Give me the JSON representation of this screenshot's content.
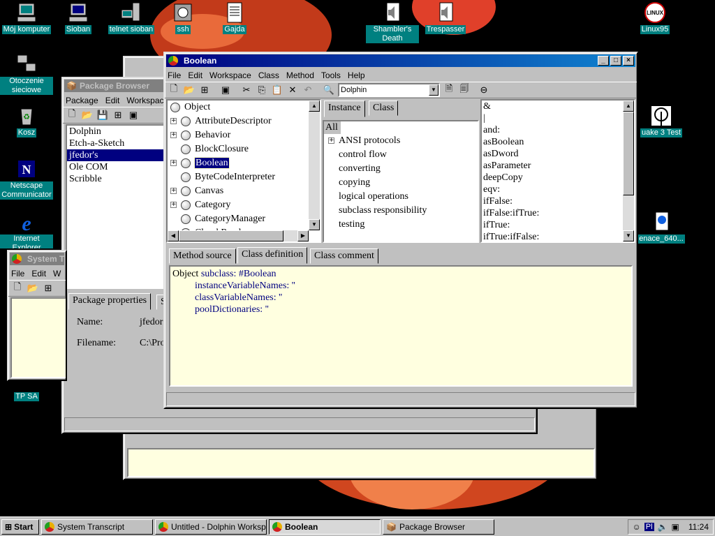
{
  "desktop_icons": [
    {
      "name": "my-computer",
      "label": "Mój komputer",
      "icon": "computer-icon"
    },
    {
      "name": "sioban",
      "label": "Sioban",
      "icon": "computer-icon"
    },
    {
      "name": "telnet-sioban",
      "label": "telnet sioban",
      "icon": "network-icon"
    },
    {
      "name": "ssh",
      "label": "ssh",
      "icon": "safe-icon"
    },
    {
      "name": "gajda",
      "label": "Gajda",
      "icon": "document-icon"
    },
    {
      "name": "shamblers-death",
      "label": "Shambler's Death",
      "icon": "sound-icon"
    },
    {
      "name": "trespasser",
      "label": "Trespasser",
      "icon": "sound-icon"
    },
    {
      "name": "linux95",
      "label": "Linux95",
      "icon": "linux-icon"
    },
    {
      "name": "network-neighborhood",
      "label": "Otoczenie sieciowe",
      "icon": "network-icon"
    },
    {
      "name": "recycle-bin",
      "label": "Kosz",
      "icon": "recycle-icon"
    },
    {
      "name": "netscape",
      "label": "Netscape Communicator",
      "icon": "netscape-icon"
    },
    {
      "name": "internet-explorer",
      "label": "Internet Explorer",
      "icon": "ie-icon"
    },
    {
      "name": "tp-sa",
      "label": "TP SA",
      "icon": "phone-icon"
    },
    {
      "name": "quake3",
      "label": "uake 3 Test",
      "icon": "quake-icon"
    },
    {
      "name": "menace",
      "label": "enace_640...",
      "icon": "movie-icon"
    }
  ],
  "workspace_window": {
    "title": "Untitled - Dolphin Workspace"
  },
  "system_transcript": {
    "title": "System T",
    "menu": [
      "File",
      "Edit",
      "W"
    ]
  },
  "package_browser": {
    "title": "Package Browser",
    "menu": [
      "Package",
      "Edit",
      "Workspac"
    ],
    "packages": [
      "Dolphin",
      "Etch-a-Sketch",
      "jfedor's",
      "Ole COM",
      "Scribble"
    ],
    "selected_package": "jfedor's",
    "tabs": [
      "Package properties",
      "S"
    ],
    "props": [
      {
        "label": "Name:",
        "value": "jfedor"
      },
      {
        "label": "Filename:",
        "value": "C:\\Pro"
      }
    ]
  },
  "boolean_window": {
    "title": "Boolean",
    "menu": [
      "File",
      "Edit",
      "Workspace",
      "Class",
      "Method",
      "Tools",
      "Help"
    ],
    "namespace_combo": "Dolphin",
    "class_tree": [
      {
        "label": "Object",
        "expander": "",
        "level": 0
      },
      {
        "label": "AttributeDescriptor",
        "expander": "+",
        "level": 1
      },
      {
        "label": "Behavior",
        "expander": "+",
        "level": 1
      },
      {
        "label": "BlockClosure",
        "expander": "",
        "level": 1
      },
      {
        "label": "Boolean",
        "expander": "+",
        "level": 1,
        "selected": true
      },
      {
        "label": "ByteCodeInterpreter",
        "expander": "",
        "level": 1
      },
      {
        "label": "Canvas",
        "expander": "+",
        "level": 1
      },
      {
        "label": "Category",
        "expander": "+",
        "level": 1
      },
      {
        "label": "CategoryManager",
        "expander": "",
        "level": 1
      },
      {
        "label": "ChunkReader",
        "expander": "",
        "level": 1
      }
    ],
    "side_tabs": [
      "Instance",
      "Class"
    ],
    "categories_all": "All",
    "categories": [
      {
        "label": "ANSI protocols",
        "expander": "+"
      },
      {
        "label": "control flow",
        "expander": ""
      },
      {
        "label": "converting",
        "expander": ""
      },
      {
        "label": "copying",
        "expander": ""
      },
      {
        "label": "logical operations",
        "expander": ""
      },
      {
        "label": "subclass responsibility",
        "expander": ""
      },
      {
        "label": "testing",
        "expander": ""
      }
    ],
    "methods": [
      "&",
      "|",
      "and:",
      "asBoolean",
      "asDword",
      "asParameter",
      "deepCopy",
      "eqv:",
      "ifFalse:",
      "ifFalse:ifTrue:",
      "ifTrue:",
      "ifTrue:ifFalse:"
    ],
    "bottom_tabs": [
      "Method source",
      "Class definition",
      "Class comment"
    ],
    "selected_bottom_tab": "Class definition",
    "definition": {
      "receiver": "Object",
      "line1_keyword": "subclass:",
      "line1_value": "#Boolean",
      "line2": "instanceVariableNames: ''",
      "line3": "classVariableNames: ''",
      "line4": "poolDictionaries: ''"
    }
  },
  "taskbar": {
    "start": "Start",
    "tasks": [
      "System Transcript",
      "Untitled - Dolphin Workspa...",
      "Boolean",
      "Package Browser"
    ],
    "active_task": "Boolean",
    "tray_lang": "Pl",
    "clock": "11:24"
  },
  "colors": {
    "titlebar": "#000080",
    "editor_bg": "#ffffe0",
    "code_blue": "#000080",
    "desktop_label_bg": "#008080"
  }
}
